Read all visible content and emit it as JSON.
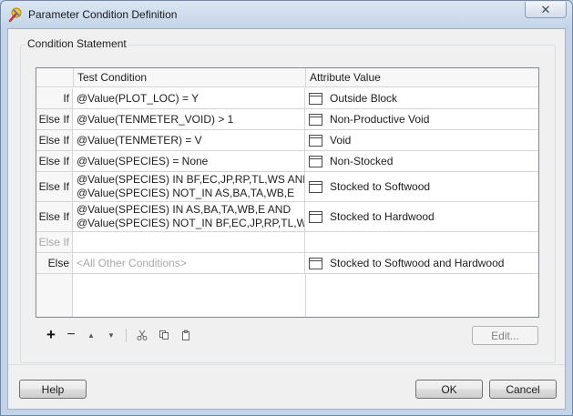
{
  "window": {
    "title": "Parameter Condition Definition",
    "close_glyph": "✕"
  },
  "group": {
    "legend": "Condition Statement"
  },
  "grid": {
    "headers": {
      "test_condition": "Test Condition",
      "attribute_value": "Attribute Value"
    },
    "rows": [
      {
        "label": "If",
        "condition_lines": [
          "@Value(PLOT_LOC) = Y"
        ],
        "value": "Outside Block"
      },
      {
        "label": "Else If",
        "condition_lines": [
          "@Value(TENMETER_VOID) > 1"
        ],
        "value": "Non-Productive Void"
      },
      {
        "label": "Else If",
        "condition_lines": [
          "@Value(TENMETER) = V"
        ],
        "value": "Void"
      },
      {
        "label": "Else If",
        "condition_lines": [
          "@Value(SPECIES) = None"
        ],
        "value": "Non-Stocked"
      },
      {
        "label": "Else If",
        "condition_lines": [
          "@Value(SPECIES) IN BF,EC,JP,RP,TL,WS AND",
          "@Value(SPECIES) NOT_IN AS,BA,TA,WB,E"
        ],
        "value": "Stocked to Softwood"
      },
      {
        "label": "Else If",
        "condition_lines": [
          "@Value(SPECIES) IN AS,BA,TA,WB,E AND",
          "@Value(SPECIES) NOT_IN BF,EC,JP,RP,TL,WS"
        ],
        "value": "Stocked to Hardwood"
      },
      {
        "label": "Else If",
        "condition_lines": [
          ""
        ],
        "value": ""
      },
      {
        "label": "Else",
        "condition_lines": [
          "<All Other Conditions>"
        ],
        "value": "Stocked to Softwood and Hardwood"
      }
    ]
  },
  "toolbar": {
    "add_glyph": "+",
    "remove_glyph": "−",
    "move_up_glyph": "▲",
    "move_down_glyph": "▼",
    "cut_icon": "scissors-icon",
    "copy_icon": "copy-icon",
    "paste_icon": "clipboard-icon"
  },
  "buttons": {
    "edit": "Edit...",
    "help": "Help",
    "ok": "OK",
    "cancel": "Cancel"
  }
}
